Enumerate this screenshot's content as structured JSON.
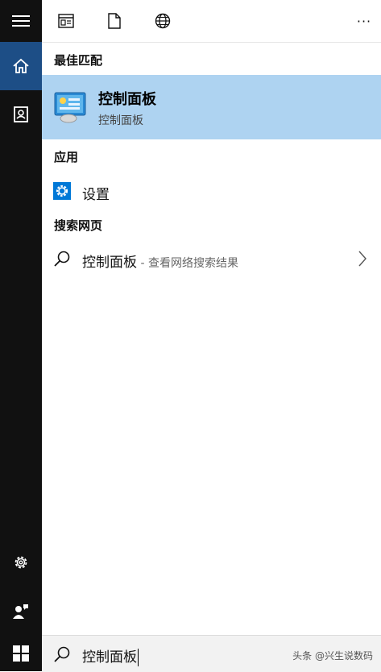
{
  "toolbar": {
    "more_label": "···"
  },
  "best_match": {
    "heading": "最佳匹配",
    "title": "控制面板",
    "subtitle": "控制面板"
  },
  "apps": {
    "heading": "应用",
    "items": [
      {
        "label": "设置"
      }
    ]
  },
  "web": {
    "heading": "搜索网页",
    "query": "控制面板",
    "hint": " - 查看网络搜索结果"
  },
  "search": {
    "value": "控制面板"
  },
  "watermark": "头条 @兴生说数码",
  "colors": {
    "rail": "#111111",
    "rail_active": "#1d4e86",
    "highlight": "#aed3f1",
    "settings_icon": "#0078d7"
  },
  "icons": {
    "rail": [
      "hamburger-icon",
      "home-icon",
      "notebook-icon",
      "gear-icon",
      "person-icon",
      "windows-logo-icon"
    ],
    "toolbar": [
      "apps-icon",
      "document-icon",
      "globe-icon",
      "more-icon"
    ]
  }
}
